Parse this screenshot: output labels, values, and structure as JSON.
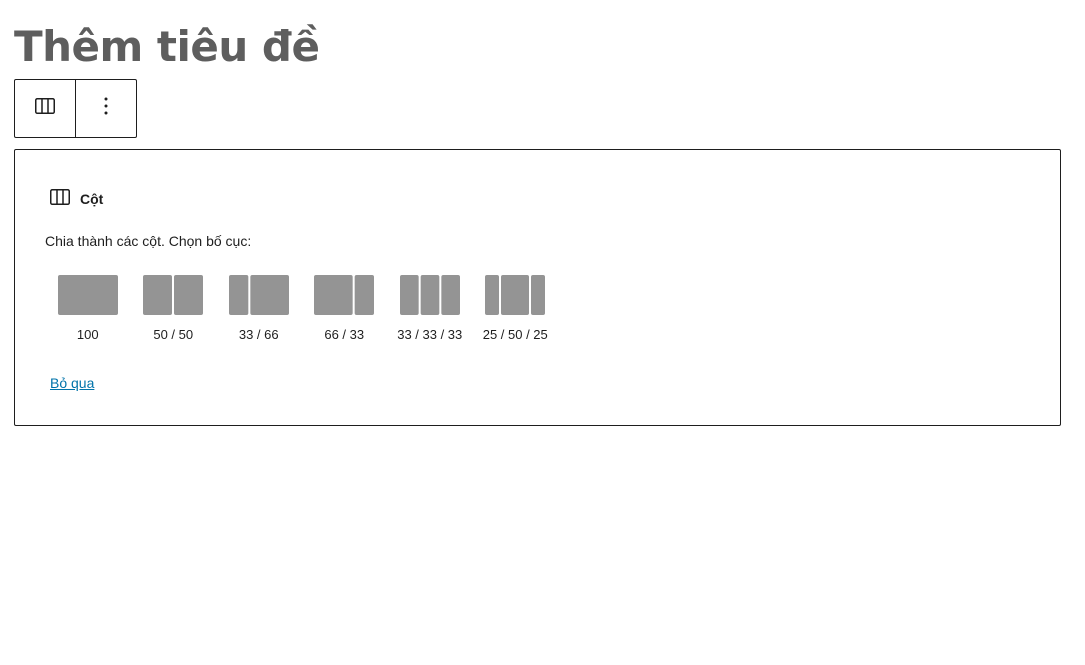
{
  "editor": {
    "title": "Thêm tiêu đề"
  },
  "toolbar": {
    "block_type_icon": "columns-icon",
    "options_icon": "more-vertical-icon"
  },
  "placeholder": {
    "label": "Cột",
    "label_icon": "columns-icon",
    "instructions": "Chia thành các cột. Chọn bố cục:",
    "variations": [
      {
        "label": "100",
        "widths": [
          100
        ]
      },
      {
        "label": "50 / 50",
        "widths": [
          50,
          50
        ]
      },
      {
        "label": "33 / 66",
        "widths": [
          33,
          66
        ]
      },
      {
        "label": "66 / 33",
        "widths": [
          66,
          33
        ]
      },
      {
        "label": "33 / 33 / 33",
        "widths": [
          33,
          33,
          33
        ]
      },
      {
        "label": "25 / 50 / 25",
        "widths": [
          25,
          50,
          25
        ]
      }
    ],
    "skip_label": "Bỏ qua"
  },
  "colors": {
    "title": "#5e5e5e",
    "variation_fill": "#949494",
    "link": "#0073aa",
    "border": "#1e1e1e"
  }
}
